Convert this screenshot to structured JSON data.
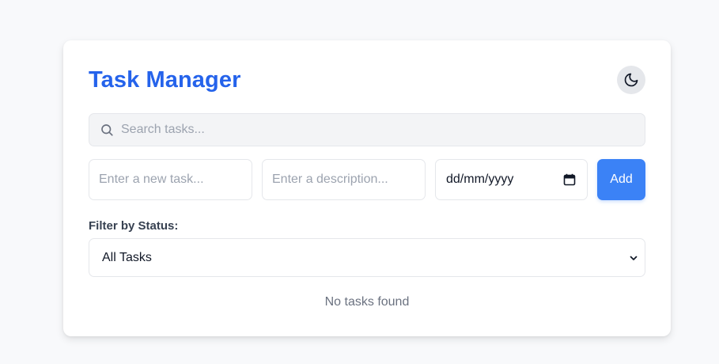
{
  "header": {
    "title": "Task Manager",
    "theme_toggle_icon": "moon-icon"
  },
  "search": {
    "placeholder": "Search tasks...",
    "value": "",
    "icon": "search-icon"
  },
  "new_task": {
    "title_placeholder": "Enter a new task...",
    "description_placeholder": "Enter a description...",
    "date_value": "dd/mm/yyyy",
    "date_icon": "calendar-icon",
    "add_label": "Add"
  },
  "filter": {
    "label": "Filter by Status:",
    "selected": "All Tasks",
    "icon": "chevron-down-icon"
  },
  "task_list": {
    "empty_message": "No tasks found"
  },
  "colors": {
    "accent": "#2563eb",
    "button": "#3b82f6",
    "background": "#f8f9fb"
  }
}
